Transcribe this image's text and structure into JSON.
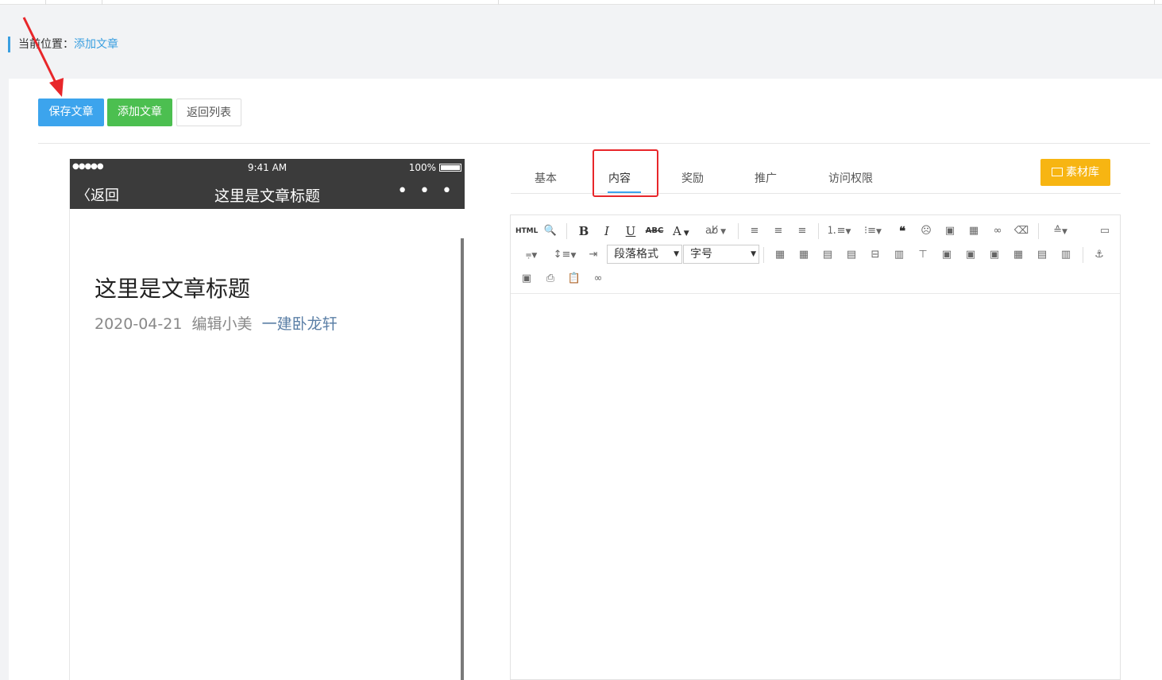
{
  "breadcrumb": {
    "prefix": "当前位置：",
    "current": "添加文章"
  },
  "actions": {
    "save": "保存文章",
    "add": "添加文章",
    "back": "返回列表"
  },
  "phone": {
    "signal": "●●●●●",
    "time": "9:41 AM",
    "battery": "100%",
    "back_label": "返回",
    "nav_title": "这里是文章标题",
    "more": "• • •",
    "article_title": "这里是文章标题",
    "date": "2020-04-21",
    "editor_name": "编辑小美",
    "author": "一建卧龙轩"
  },
  "tabs": [
    {
      "label": "基本"
    },
    {
      "label": "内容",
      "active": true
    },
    {
      "label": "奖励"
    },
    {
      "label": "推广"
    },
    {
      "label": "访问权限"
    }
  ],
  "material_library": "素材库",
  "toolbar": {
    "html": "HTML",
    "bold": "B",
    "italic": "I",
    "underline": "U",
    "strike": "ABC",
    "font_color": "A",
    "paragraph_select": "段落格式",
    "size_select": "字号"
  },
  "colors": {
    "primary": "#3ca4ed",
    "success": "#4cbf50",
    "warning": "#f7b512",
    "annotation": "#e8262a"
  }
}
